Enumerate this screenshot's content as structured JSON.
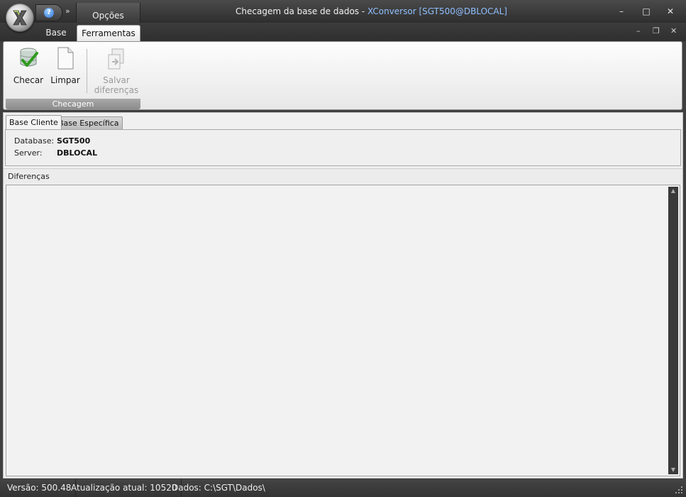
{
  "titlebar": {
    "title": "Checagem da base de dados",
    "separator": " - ",
    "subtitle": "XConversor [SGT500@DBLOCAL]",
    "opcoes_label": "Opções",
    "qat_more": "»",
    "help_glyph": "?",
    "minimize": "–",
    "maximize": "□",
    "close": "✕"
  },
  "ribbon": {
    "tabs": [
      {
        "label": "Base",
        "active": false
      },
      {
        "label": "Ferramentas",
        "active": true
      }
    ],
    "mdi": {
      "minimize": "–",
      "restore": "❐",
      "close": "✕"
    },
    "group": {
      "label": "Checagem",
      "buttons": [
        {
          "label": "Checar",
          "icon": "database-check-icon",
          "enabled": true
        },
        {
          "label": "Limpar",
          "icon": "blank-document-icon",
          "enabled": true
        },
        {
          "label_line1": "Salvar",
          "label_line2": "diferenças",
          "icon": "save-differences-icon",
          "enabled": false
        }
      ]
    }
  },
  "panel": {
    "tabs": [
      {
        "label": "Base Cliente",
        "active": true
      },
      {
        "label": "Base Específica",
        "active": false
      }
    ],
    "database_label": "Database:",
    "database_value": "SGT500",
    "server_label": "Server:",
    "server_value": "DBLOCAL",
    "diferencas_label": "Diferenças"
  },
  "statusbar": {
    "versao": "Versão: 500.48",
    "atualizacao": "Atualização atual: 10520",
    "dados": "Dados: C:\\SGT\\Dados\\"
  }
}
